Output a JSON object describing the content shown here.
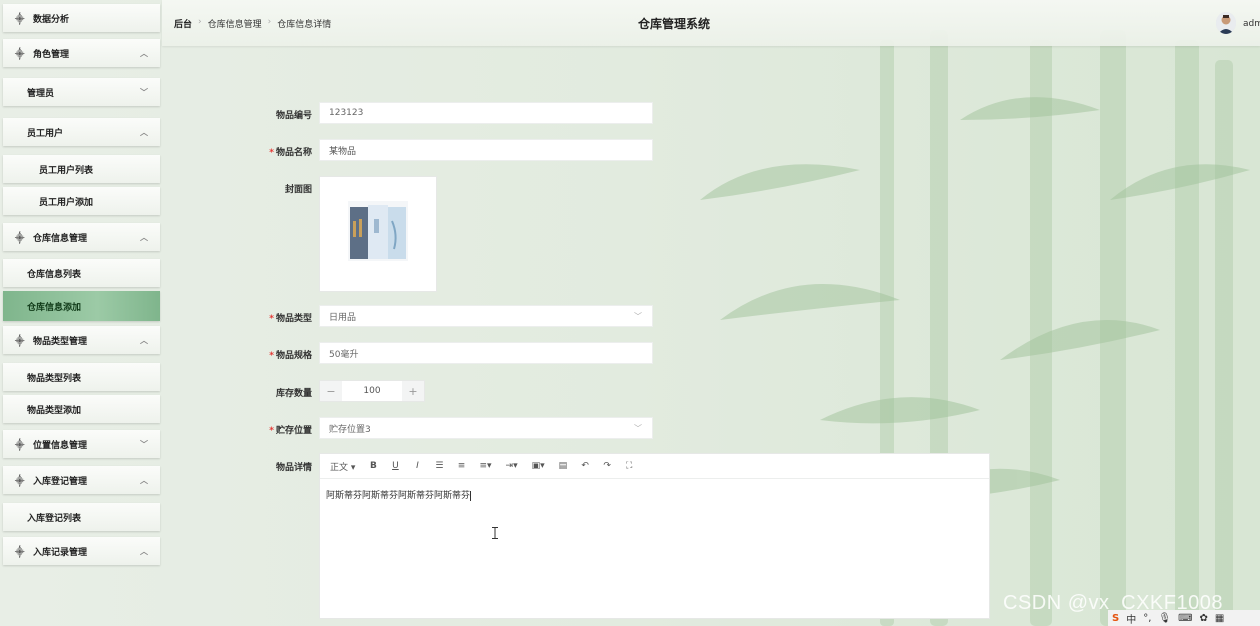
{
  "header": {
    "breadcrumb": [
      "后台",
      "仓库信息管理",
      "仓库信息详情"
    ],
    "system_title": "仓库管理系统",
    "user": "adm"
  },
  "sidebar": {
    "items": [
      {
        "label": "数据分析",
        "level": 0,
        "icon": "tree-icon",
        "chevron": ""
      },
      {
        "label": "角色管理",
        "level": 0,
        "icon": "tree-icon",
        "chevron": "^"
      },
      {
        "label": "管理员",
        "level": 1,
        "chevron": "v"
      },
      {
        "label": "员工用户",
        "level": 1,
        "chevron": "^"
      },
      {
        "label": "员工用户列表",
        "level": 2,
        "chevron": ""
      },
      {
        "label": "员工用户添加",
        "level": 2,
        "chevron": ""
      },
      {
        "label": "仓库信息管理",
        "level": 0,
        "icon": "tree-icon",
        "chevron": "^"
      },
      {
        "label": "仓库信息列表",
        "level": 1,
        "chevron": ""
      },
      {
        "label": "仓库信息添加",
        "level": 1,
        "chevron": "",
        "active": true
      },
      {
        "label": "物品类型管理",
        "level": 0,
        "icon": "tree-icon",
        "chevron": "^"
      },
      {
        "label": "物品类型列表",
        "level": 1,
        "chevron": ""
      },
      {
        "label": "物品类型添加",
        "level": 1,
        "chevron": ""
      },
      {
        "label": "位置信息管理",
        "level": 0,
        "icon": "tree-icon",
        "chevron": "v"
      },
      {
        "label": "入库登记管理",
        "level": 0,
        "icon": "tree-icon",
        "chevron": "^"
      },
      {
        "label": "入库登记列表",
        "level": 1,
        "chevron": ""
      },
      {
        "label": "入库记录管理",
        "level": 0,
        "icon": "tree-icon",
        "chevron": "^"
      }
    ]
  },
  "form": {
    "item_no": {
      "label": "物品编号",
      "value": "123123"
    },
    "item_name": {
      "label": "物品名称",
      "value": "某物品",
      "required": true
    },
    "cover": {
      "label": "封面图"
    },
    "item_type": {
      "label": "物品类型",
      "value": "日用品",
      "required": true
    },
    "spec": {
      "label": "物品规格",
      "value": "50毫升",
      "required": true
    },
    "stock": {
      "label": "库存数量",
      "value": "100",
      "minus": "−",
      "plus": "+"
    },
    "location": {
      "label": "贮存位置",
      "value": "贮存位置3",
      "required": true
    },
    "detail": {
      "label": "物品详情",
      "content": "阿斯蒂芬阿斯蒂芬阿斯蒂芬阿斯蒂芬",
      "toolbar": {
        "paragraph": "正文 ▾",
        "bold": "B",
        "underline": "U",
        "italic": "I",
        "ul": "☰",
        "ol": "≡",
        "align": "≡▾",
        "indent": "⇥▾",
        "image": "▣▾",
        "hr": "▤",
        "undo": "↶",
        "redo": "↷",
        "fullscreen": "⛶"
      }
    }
  },
  "watermark": "CSDN @vx_CXKF1008",
  "tray": {
    "ime": "S",
    "lang": "中",
    "punct": "°,"
  }
}
